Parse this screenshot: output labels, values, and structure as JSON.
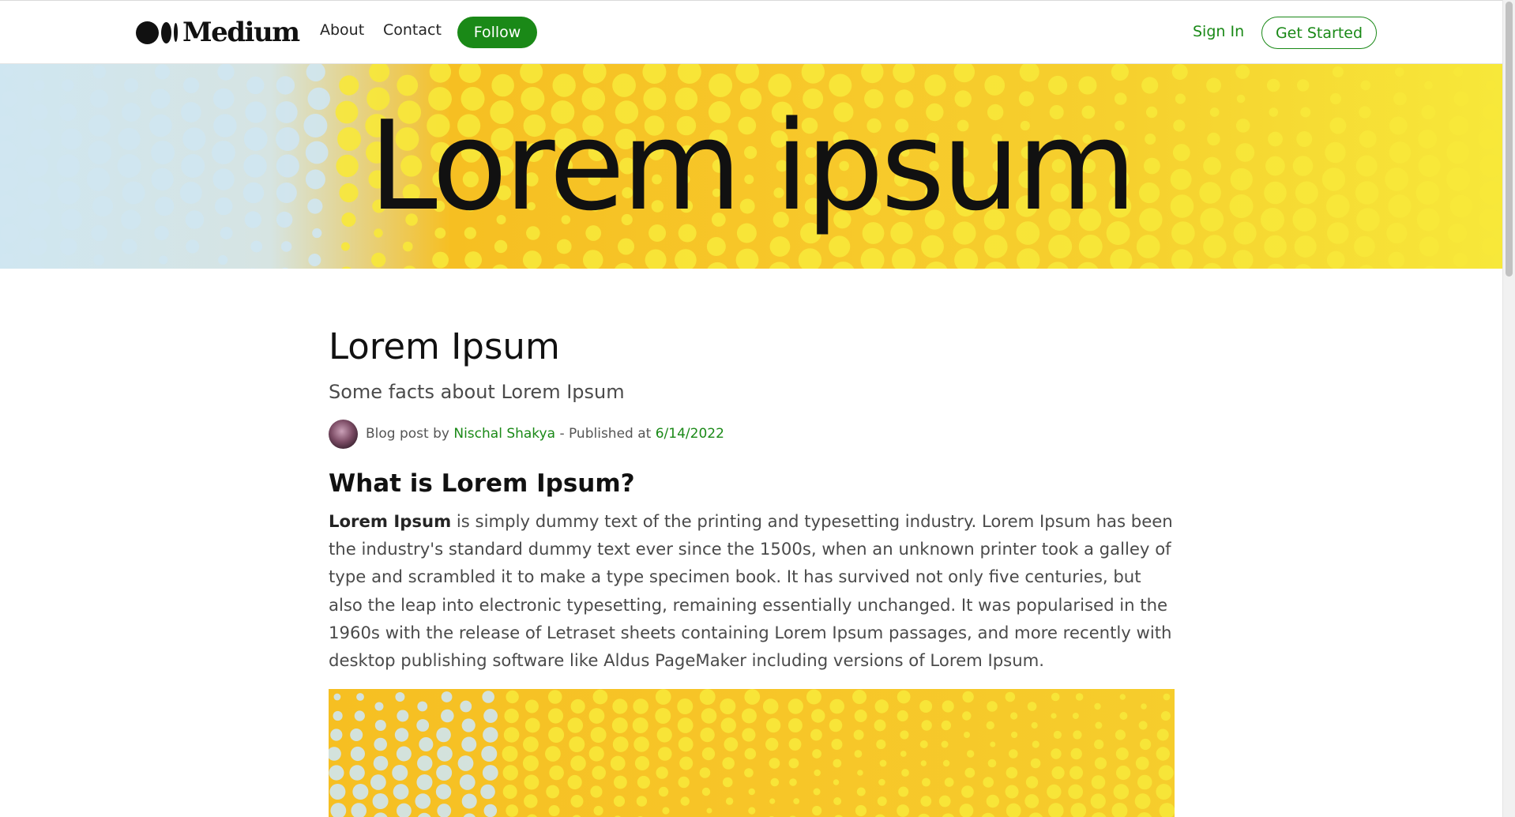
{
  "navbar": {
    "logo_text": "Medium",
    "links": [
      "About",
      "Contact"
    ],
    "follow_label": "Follow",
    "signin_label": "Sign In",
    "get_started_label": "Get Started",
    "accent_color": "#1a8917"
  },
  "hero": {
    "banner_text": "Lorem ipsum",
    "colors": {
      "yellow": "#f7e83a",
      "orange": "#f6bf22",
      "light_blue": "#cfe6f1"
    }
  },
  "article": {
    "title": "Lorem Ipsum",
    "subtitle": "Some facts about Lorem Ipsum",
    "byline": {
      "prefix": "Blog post by",
      "author": "Nischal Shakya",
      "separator": "- Published at",
      "date": "6/14/2022"
    },
    "heading": "What is Lorem Ipsum?",
    "paragraph": {
      "lead": "Lorem Ipsum",
      "text": " is simply dummy text of the printing and typesetting industry. Lorem Ipsum has been the industry's standard dummy text ever since the 1500s, when an unknown printer took a galley of type and scrambled it to make a type specimen book. It has survived not only five centuries, but also the leap into electronic typesetting, remaining essentially unchanged. It was popularised in the 1960s with the release of Letraset sheets containing Lorem Ipsum passages, and more recently with desktop publishing software like Aldus PageMaker including versions of Lorem Ipsum."
    }
  }
}
